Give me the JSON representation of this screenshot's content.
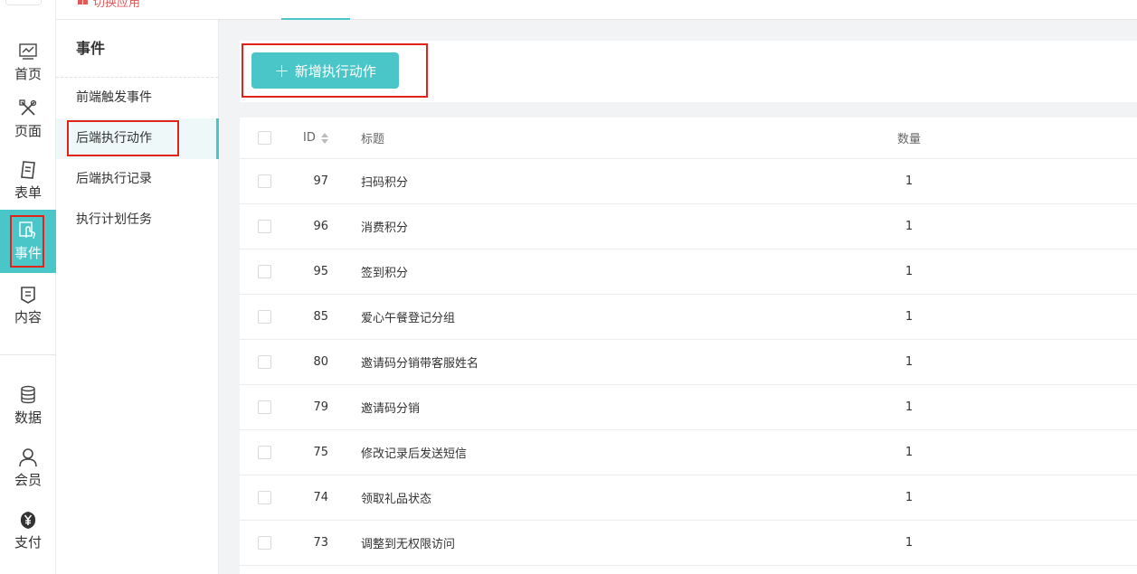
{
  "topbar": {
    "app_switch_label": "切换应用"
  },
  "rail": {
    "items": [
      {
        "label": "首页",
        "icon": "chart-icon"
      },
      {
        "label": "页面",
        "icon": "design-tools-icon"
      },
      {
        "label": "表单",
        "icon": "form-icon"
      },
      {
        "label": "事件",
        "icon": "touch-icon",
        "active": true
      },
      {
        "label": "内容",
        "icon": "document-icon"
      },
      {
        "label": "数据",
        "icon": "database-icon"
      },
      {
        "label": "会员",
        "icon": "user-icon"
      },
      {
        "label": "支付",
        "icon": "yen-icon"
      }
    ]
  },
  "submenu": {
    "title": "事件",
    "items": [
      {
        "label": "前端触发事件"
      },
      {
        "label": "后端执行动作",
        "active": true
      },
      {
        "label": "后端执行记录"
      },
      {
        "label": "执行计划任务"
      }
    ]
  },
  "toolbar": {
    "add_label": "新增执行动作"
  },
  "table": {
    "headers": {
      "id": "ID",
      "title": "标题",
      "qty": "数量"
    },
    "rows": [
      {
        "id": "97",
        "title": "扫码积分",
        "qty": "1"
      },
      {
        "id": "96",
        "title": "消费积分",
        "qty": "1"
      },
      {
        "id": "95",
        "title": "签到积分",
        "qty": "1"
      },
      {
        "id": "85",
        "title": "爱心午餐登记分组",
        "qty": "1"
      },
      {
        "id": "80",
        "title": "邀请码分销带客服姓名",
        "qty": "1"
      },
      {
        "id": "79",
        "title": "邀请码分销",
        "qty": "1"
      },
      {
        "id": "75",
        "title": "修改记录后发送短信",
        "qty": "1"
      },
      {
        "id": "74",
        "title": "领取礼品状态",
        "qty": "1"
      },
      {
        "id": "73",
        "title": "调整到无权限访问",
        "qty": "1"
      }
    ]
  },
  "colors": {
    "accent": "#4bc6c8",
    "highlight": "#e2231a"
  }
}
